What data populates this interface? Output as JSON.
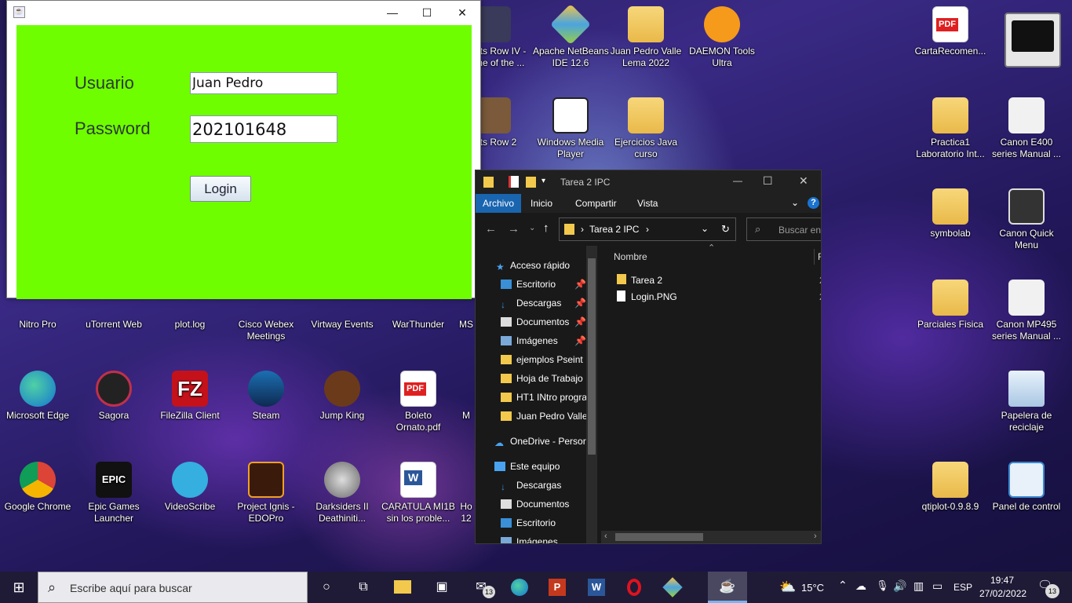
{
  "java_window": {
    "icon": "java-icon",
    "controls": {
      "minimize": "—",
      "maximize": "☐",
      "close": "✕"
    },
    "usuario_label": "Usuario",
    "usuario_value": "Juan Pedro",
    "password_label": "Password",
    "password_value": "202101648",
    "login_label": "Login",
    "panel_color": "#6ffe00"
  },
  "desktop_icons": [
    {
      "label": "nts Row IV -\nme of the ..."
    },
    {
      "label": "Apache NetBeans\nIDE 12.6"
    },
    {
      "label": "Juan Pedro Valle\nLema 2022"
    },
    {
      "label": "DAEMON Tools\nUltra"
    },
    {
      "label": "CartaRecomen..."
    },
    {
      "label": "nts Row 2"
    },
    {
      "label": "Windows Media\nPlayer"
    },
    {
      "label": "Ejercicios Java\ncurso"
    },
    {
      "label": "Practica1\nLaboratorio Int..."
    },
    {
      "label": "Canon E400\nseries Manual ..."
    },
    {
      "label": "symbolab"
    },
    {
      "label": "Canon Quick\nMenu"
    },
    {
      "label": "Nitro Pro"
    },
    {
      "label": "uTorrent Web"
    },
    {
      "label": "plot.log"
    },
    {
      "label": "Cisco Webex\nMeetings"
    },
    {
      "label": "Virtway Events"
    },
    {
      "label": "WarThunder"
    },
    {
      "label": "MS"
    },
    {
      "label": "Parciales Fisica"
    },
    {
      "label": "Canon MP495\nseries Manual ..."
    },
    {
      "label": "Microsoft Edge"
    },
    {
      "label": "Sagora"
    },
    {
      "label": "FileZilla Client"
    },
    {
      "label": "Steam"
    },
    {
      "label": "Jump King"
    },
    {
      "label": "Boleto\nOrnato.pdf"
    },
    {
      "label": "M"
    },
    {
      "label": "Papelera de\nreciclaje"
    },
    {
      "label": "Google Chrome"
    },
    {
      "label": "Epic Games\nLauncher"
    },
    {
      "label": "VideoScribe"
    },
    {
      "label": "Project Ignis -\nEDOPro"
    },
    {
      "label": "Darksiders II\nDeathiniti..."
    },
    {
      "label": "CARATULA MI1B\nsin los proble..."
    },
    {
      "label": "Ho\n12"
    },
    {
      "label": "qtiplot-0.9.8.9"
    },
    {
      "label": "Panel de control"
    }
  ],
  "explorer": {
    "title": "Tarea 2 IPC",
    "controls": {
      "minimize": "—",
      "maximize": "☐",
      "close": "✕"
    },
    "ribbon_tabs": [
      "Archivo",
      "Inicio",
      "Compartir",
      "Vista"
    ],
    "help": "?",
    "address": {
      "chevron": "›",
      "path": "Tarea 2 IPC",
      "after": "›"
    },
    "search_placeholder": "Buscar en",
    "nav_items": [
      {
        "label": "Acceso rápido"
      },
      {
        "label": "Escritorio"
      },
      {
        "label": "Descargas"
      },
      {
        "label": "Documentos"
      },
      {
        "label": "Imágenes"
      },
      {
        "label": "ejemplos Pseint"
      },
      {
        "label": "Hoja de Trabajo"
      },
      {
        "label": "HT1 INtro progra"
      },
      {
        "label": "Juan Pedro Valle"
      },
      {
        "label": "OneDrive - Persor"
      },
      {
        "label": "Este equipo"
      },
      {
        "label": "Descargas"
      },
      {
        "label": "Documentos"
      },
      {
        "label": "Escritorio"
      },
      {
        "label": "Imágenes"
      }
    ],
    "column_header": "Nombre",
    "column_header_2": "F",
    "files": [
      {
        "name": "Tarea 2",
        "date": "2"
      },
      {
        "name": "Login.PNG",
        "date": "2"
      }
    ]
  },
  "taskbar": {
    "search_placeholder": "Escribe aquí para buscar",
    "weather": "15°C",
    "language": "ESP",
    "time": "19:47",
    "date": "27/02/2022",
    "notifications": "13",
    "mail_badge": "13"
  }
}
